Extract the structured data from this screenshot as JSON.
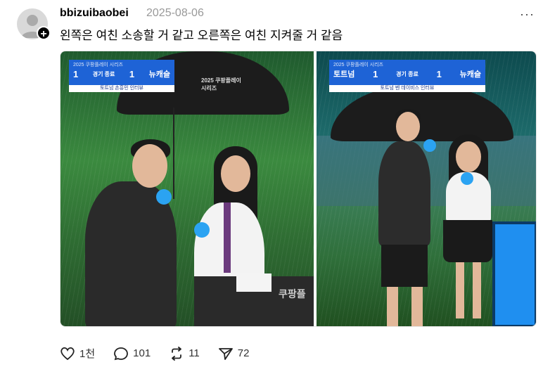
{
  "post": {
    "username": "bbizuibaobei",
    "date": "2025-08-06",
    "more_label": "···",
    "follow_label": "+",
    "caption": "왼쪽은 여친 소송할 거 같고 오른쪽은 여친 지켜줄 거 같음"
  },
  "image_left": {
    "series_title": "2025 쿠팡플레이 시리즈",
    "score_home": "1",
    "status": "경기 종료",
    "score_away": "1",
    "team_away": "뉴캐슬",
    "subtitle": "토트넘 손흥민 인터뷰",
    "umbrella_text": "2025 쿠팡플레이 시리즈",
    "desk_text": "쿠팡플"
  },
  "image_right": {
    "series_title": "2025 쿠팡플레이 시리즈",
    "team_home": "토트넘",
    "score_home": "1",
    "status": "경기 종료",
    "score_away": "1",
    "team_away": "뉴캐슬",
    "subtitle": "토트넘 벤 데이비스 인터뷰"
  },
  "actions": {
    "likes": "1천",
    "comments": "101",
    "reposts": "11",
    "shares": "72"
  },
  "colors": {
    "scoreboard_blue": "#1e63d6",
    "mic_blue": "#2ba3f2",
    "muted_text": "#999999"
  }
}
